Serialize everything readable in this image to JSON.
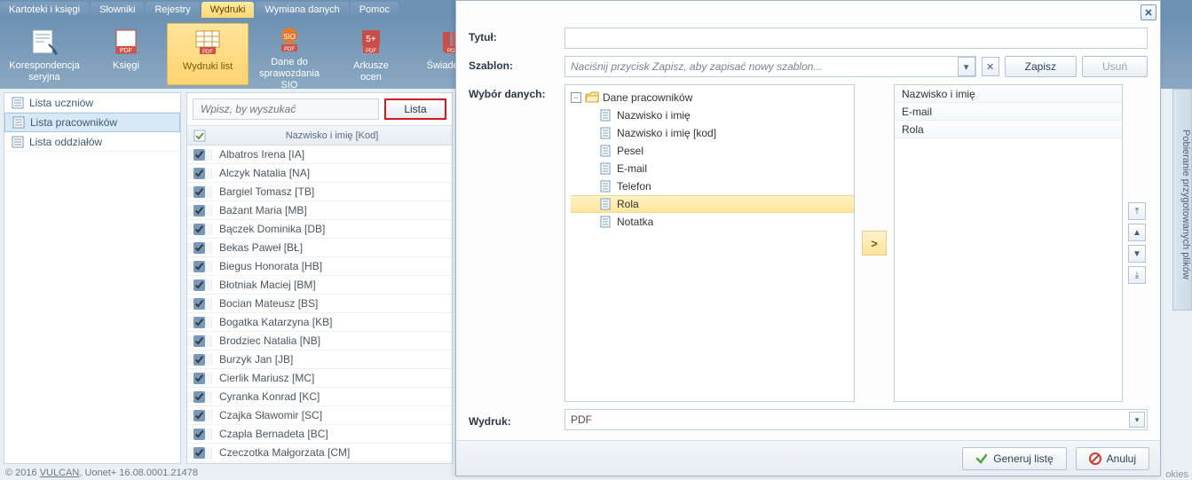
{
  "ribbon": {
    "tabs": [
      "Kartoteki i księgi",
      "Słowniki",
      "Rejestry",
      "Wydruki",
      "Wymiana danych",
      "Pomoc"
    ],
    "active_tab_index": 3,
    "buttons": [
      {
        "label_line1": "Korespondencja",
        "label_line2": "seryjna",
        "active": false
      },
      {
        "label_line1": "Księgi",
        "label_line2": "",
        "active": false
      },
      {
        "label_line1": "Wydruki list",
        "label_line2": "",
        "active": true
      },
      {
        "label_line1": "Dane do",
        "label_line2": "sprawozdania SIO",
        "active": false
      },
      {
        "label_line1": "Arkusze",
        "label_line2": "ocen",
        "active": false
      },
      {
        "label_line1": "Świadectwa",
        "label_line2": "",
        "active": false
      }
    ]
  },
  "sidebar": {
    "items": [
      {
        "label": "Lista uczniów",
        "selected": false
      },
      {
        "label": "Lista pracowników",
        "selected": true
      },
      {
        "label": "Lista oddziałów",
        "selected": false
      }
    ]
  },
  "list_panel": {
    "search_placeholder": "Wpisz, by wyszukać",
    "button_label": "Lista",
    "column_header": "Nazwisko i imię [Kod]",
    "rows": [
      "Albatros Irena [IA]",
      "Alczyk Natalia [NA]",
      "Bargiel Tomasz [TB]",
      "Bażant Maria [MB]",
      "Bączek Dominika [DB]",
      "Bekas Paweł [BŁ]",
      "Biegus Honorata [HB]",
      "Błotniak Maciej [BM]",
      "Bocian Mateusz [BS]",
      "Bogatka Katarzyna [KB]",
      "Brodziec Natalia [NB]",
      "Burzyk Jan [JB]",
      "Cierlik Mariusz [MC]",
      "Cyranka Konrad [KC]",
      "Czajka Sławomir [SC]",
      "Czapla Bernadeta [BC]",
      "Czeczotka Małgorzata [CM]"
    ]
  },
  "modal": {
    "labels": {
      "tytul": "Tytuł:",
      "szablon": "Szablon:",
      "wybor": "Wybór danych:",
      "wydruk": "Wydruk:"
    },
    "template_placeholder": "Naciśnij przycisk Zapisz, aby zapisać nowy szablon...",
    "save_btn": "Zapisz",
    "delete_btn": "Usuń",
    "tree_root": "Dane pracowników",
    "tree_items": [
      "Nazwisko i imię",
      "Nazwisko i imię [kod]",
      "Pesel",
      "E-mail",
      "Telefon",
      "Rola",
      "Notatka"
    ],
    "tree_selected_index": 5,
    "selected_fields": [
      "Nazwisko i imię",
      "E-mail",
      "Rola"
    ],
    "output_value": "PDF",
    "footer_generate": "Generuj listę",
    "footer_cancel": "Anuluj"
  },
  "right_dock": "Pobieranie przygotowanych plików",
  "status": {
    "prefix": "© 2016 ",
    "vulcan": "VULCAN",
    "suffix": ", Uonet+ 16.08.0001.21478"
  },
  "cookies": "okies"
}
